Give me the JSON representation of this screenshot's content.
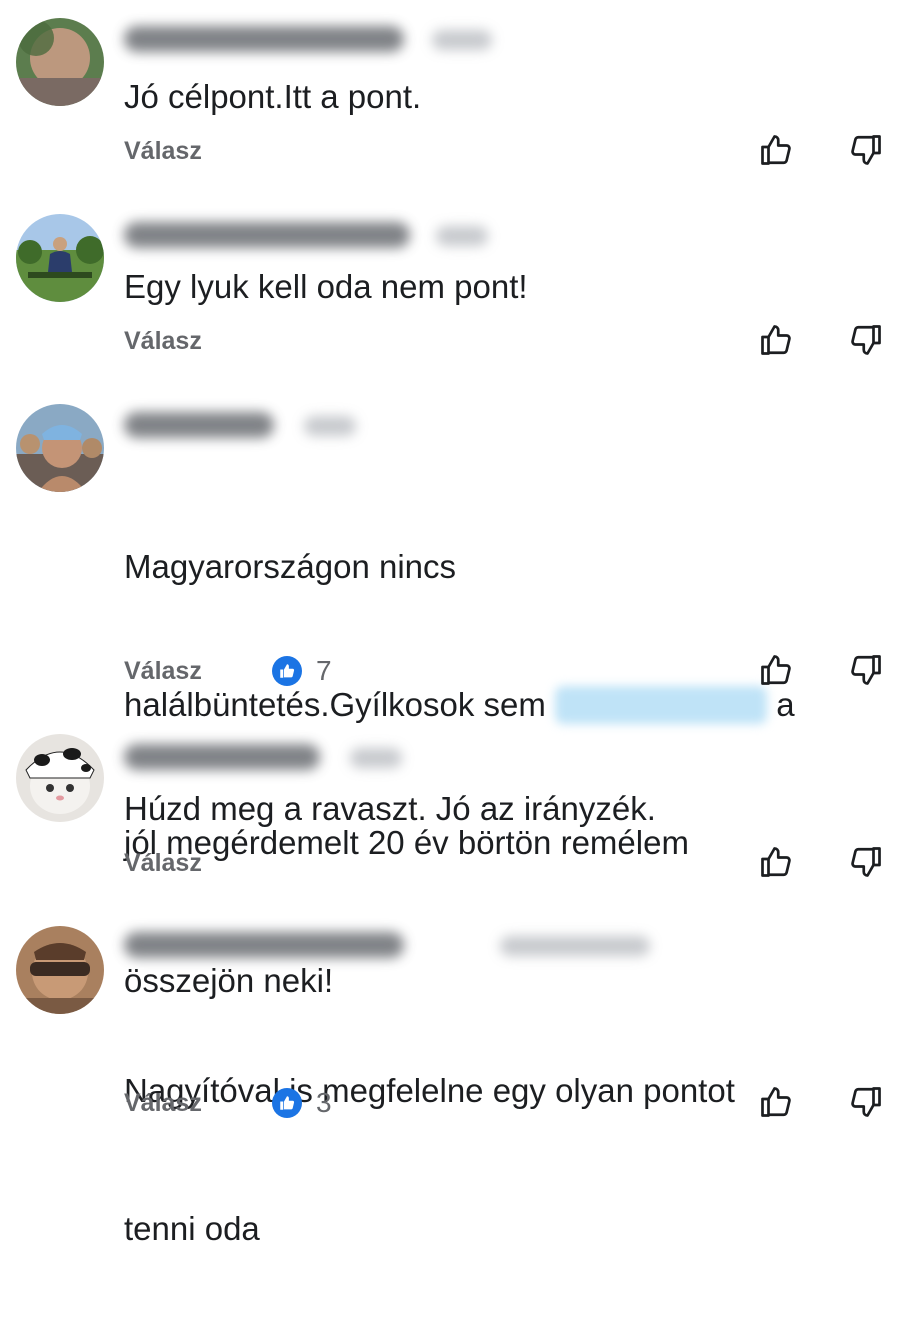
{
  "comments": [
    {
      "text": "Jó célpont.Itt a pont.",
      "reply_label": "Válasz",
      "reaction_count": null,
      "like_icon": "thumbs-up-outline-icon",
      "dislike_icon": "thumbs-down-outline-icon"
    },
    {
      "text": "Egy lyuk kell oda nem pont!",
      "reply_label": "Válasz",
      "reaction_count": null,
      "like_icon": "thumbs-up-outline-icon",
      "dislike_icon": "thumbs-down-outline-icon"
    },
    {
      "text_line1": "Magyarországon nincs",
      "text_line2_pre": "halálbüntetés.Gyílkosok sem",
      "text_line2_post": "a",
      "text_line3": "jól megérdemelt 20 év börtön remélem",
      "text_line4": "összejön neki!",
      "reply_label": "Válasz",
      "reaction_count": "7",
      "reaction_icon": "like-reaction-icon"
    },
    {
      "text": "Húzd meg a ravaszt. Jó az irányzék.",
      "reply_label": "Válasz",
      "reaction_count": null
    },
    {
      "text_line1": "Nagyítóval is megfelelne egy olyan pontot",
      "text_line2": "tenni oda",
      "reply_label": "Válasz",
      "reaction_count": "3",
      "reaction_icon": "like-reaction-icon"
    }
  ],
  "colors": {
    "text": "#1c1e21",
    "secondary": "#65676b",
    "reaction_blue": "#1b74e4"
  }
}
